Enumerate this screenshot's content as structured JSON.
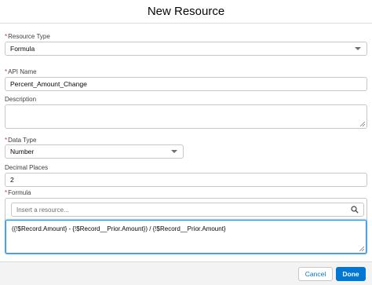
{
  "modal": {
    "title": "New Resource"
  },
  "form": {
    "resource_type": {
      "label": "Resource Type",
      "required_mark": "*",
      "value": "Formula"
    },
    "api_name": {
      "label": "API Name",
      "required_mark": "*",
      "value": "Percent_Amount_Change"
    },
    "description": {
      "label": "Description",
      "value": ""
    },
    "data_type": {
      "label": "Data Type",
      "required_mark": "*",
      "value": "Number"
    },
    "decimal_places": {
      "label": "Decimal Places",
      "value": "2"
    },
    "formula": {
      "label": "Formula",
      "required_mark": "*",
      "search_placeholder": "Insert a resource...",
      "expression": "({!$Record.Amount} - {!$Record__Prior.Amount}) / {!$Record__Prior.Amount}"
    }
  },
  "footer": {
    "cancel_label": "Cancel",
    "done_label": "Done"
  },
  "colors": {
    "brand": "#0176d3",
    "required": "#c23934",
    "focus_border": "#1b96ff"
  },
  "icons": [
    "chevron-down-icon",
    "search-icon",
    "resize-grip-icon"
  ]
}
